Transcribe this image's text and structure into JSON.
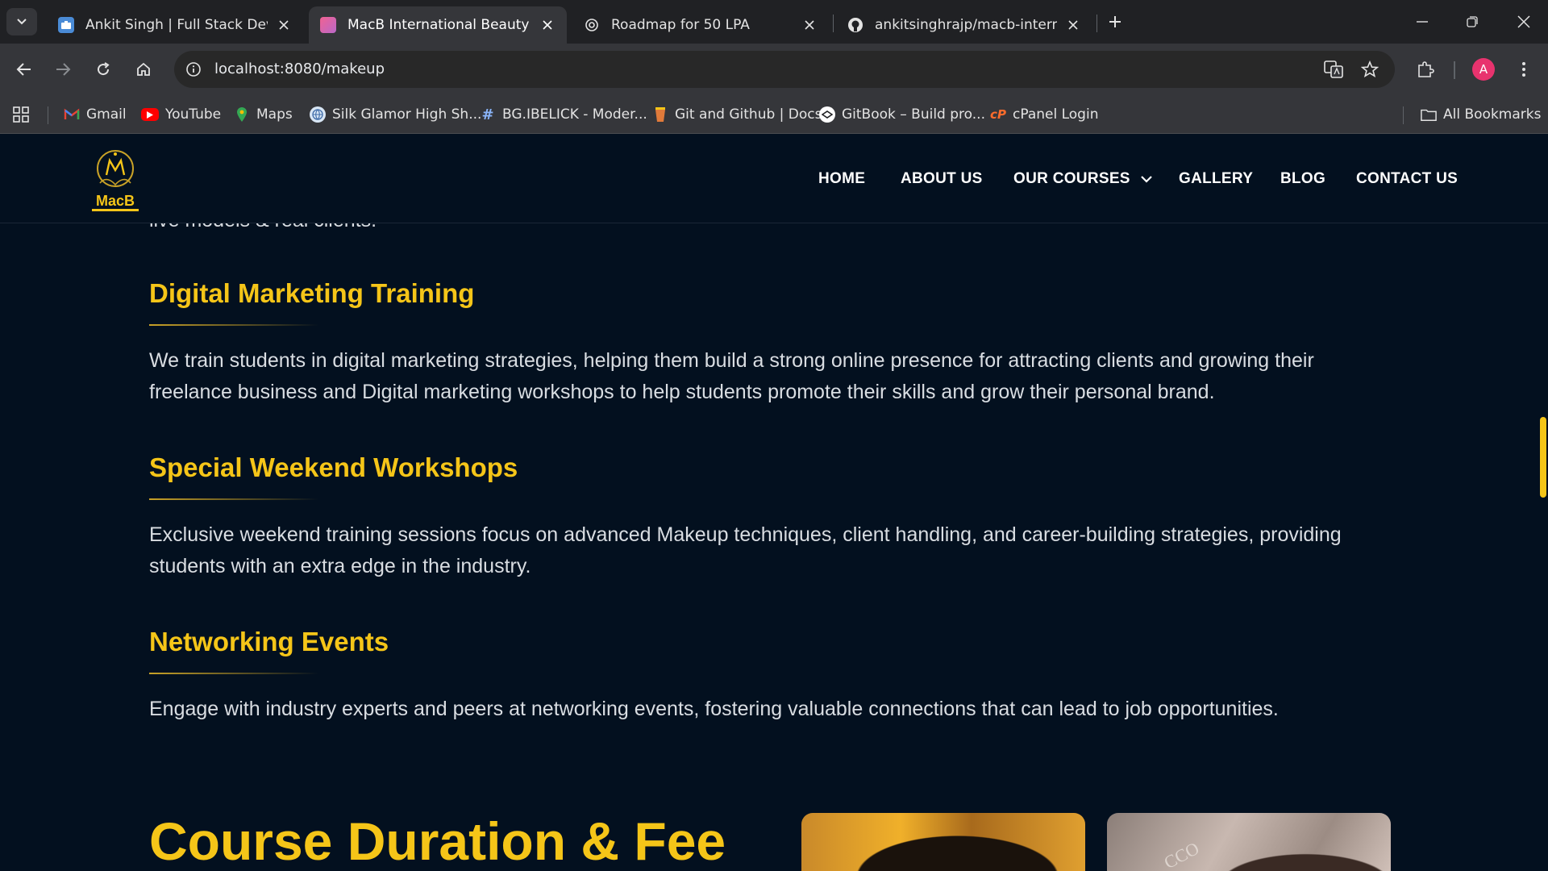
{
  "browser": {
    "tabs": [
      {
        "title": "Ankit Singh | Full Stack Develop",
        "favicon": "briefcase-icon",
        "active": false
      },
      {
        "title": "MacB International Beauty of Sc",
        "favicon": "macb-icon",
        "active": true
      },
      {
        "title": "Roadmap for 50 LPA",
        "favicon": "openai-icon",
        "active": false
      },
      {
        "title": "ankitsinghrajp/macb-internatio",
        "favicon": "github-icon",
        "active": false
      }
    ],
    "url": "localhost:8080/makeup",
    "profile_initial": "A",
    "bookmarks": [
      {
        "label": "Gmail",
        "icon": "gmail-icon"
      },
      {
        "label": "YouTube",
        "icon": "youtube-icon"
      },
      {
        "label": "Maps",
        "icon": "maps-icon"
      },
      {
        "label": "Silk Glamor High Sh...",
        "icon": "globe-icon"
      },
      {
        "label": "BG.IBELICK - Moder...",
        "icon": "hash-icon"
      },
      {
        "label": "Git and Github | Docs",
        "icon": "cup-icon"
      },
      {
        "label": "GitBook – Build pro...",
        "icon": "gitbook-icon"
      },
      {
        "label": "cPanel Login",
        "icon": "cpanel-icon"
      }
    ],
    "all_bookmarks": "All Bookmarks"
  },
  "site": {
    "logo_text": "MacB",
    "nav": [
      "HOME",
      "ABOUT US",
      "OUR COURSES",
      "GALLERY",
      "BLOG",
      "CONTACT US"
    ],
    "cutoff_text": "live models & real clients.",
    "sections": [
      {
        "title": "Digital Marketing Training",
        "body": "We train students in digital marketing strategies, helping them build a strong online presence for attracting clients and growing their freelance business and Digital marketing workshops to help students promote their skills and grow their personal brand."
      },
      {
        "title": "Special Weekend Workshops",
        "body": "Exclusive weekend training sessions focus on advanced Makeup techniques, client handling, and career-building strategies, providing students with an extra edge in the industry."
      },
      {
        "title": "Networking Events",
        "body": "Engage with industry experts and peers at networking events, fostering valuable connections that can lead to job opportunities."
      }
    ],
    "course_title": "Course Duration & Fee",
    "brush_text": "CCO"
  },
  "colors": {
    "accent": "#f5c518",
    "page_bg": "#03101f",
    "body_text": "#d9dde2"
  }
}
